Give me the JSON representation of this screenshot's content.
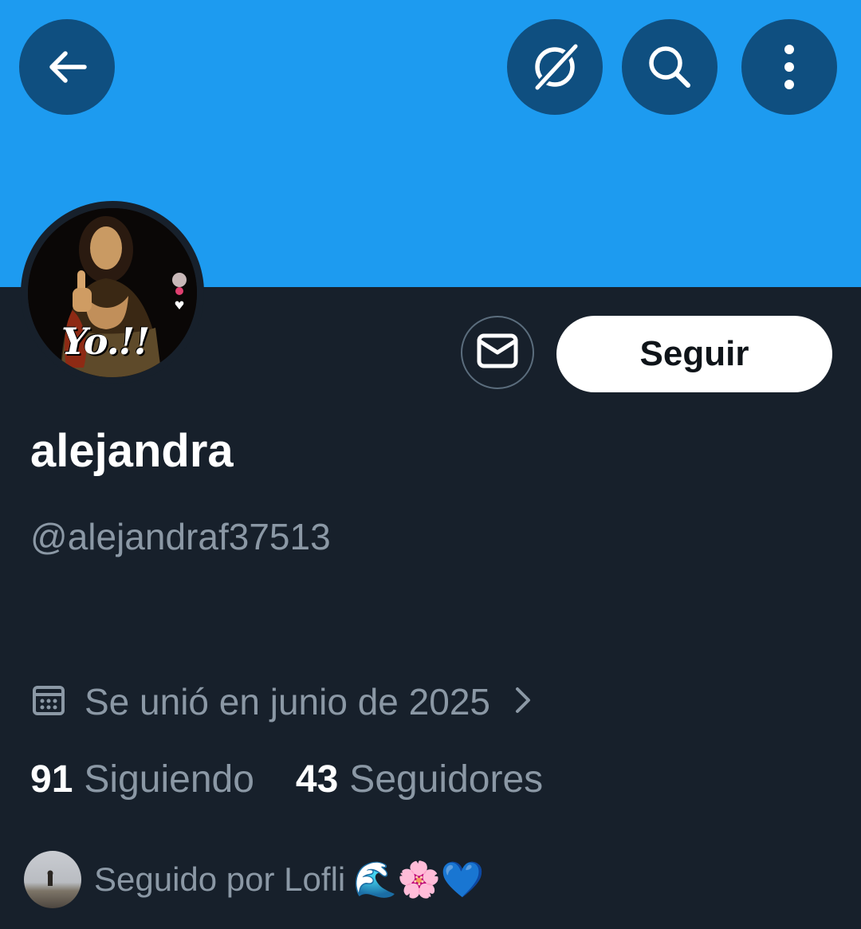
{
  "header": {
    "back_icon": "arrow-left-icon",
    "grok_icon": "grok-slash-icon",
    "search_icon": "search-icon",
    "more_icon": "more-vertical-icon",
    "banner_color": "#1d9bf0"
  },
  "profile": {
    "avatar_caption": "Yo.!!",
    "display_name": "alejandra",
    "handle": "@alejandraf37513",
    "joined": "Se unió en junio de 2025",
    "following_count": "91",
    "following_label": "Siguiendo",
    "followers_count": "43",
    "followers_label": "Seguidores",
    "followed_by": "Seguido por Lofli",
    "followed_by_emoji": "🌊🌸💙"
  },
  "actions": {
    "message_icon": "envelope-icon",
    "follow_label": "Seguir"
  }
}
